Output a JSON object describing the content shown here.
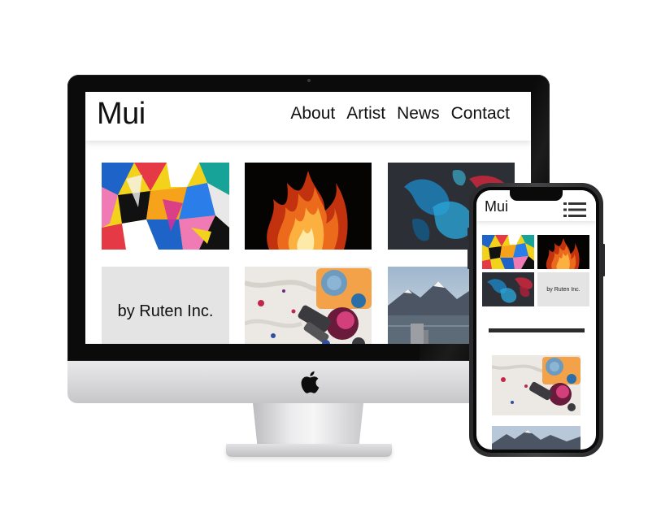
{
  "desktop_site": {
    "logo": "Mui",
    "nav": [
      "About",
      "Artist",
      "News",
      "Contact"
    ],
    "gallery_text_tile": "by Ruten Inc."
  },
  "mobile_site": {
    "logo": "Mui",
    "menu_icon": "hamburger-menu-icon",
    "gallery_text_tile": "by Ruten Inc."
  },
  "colors": {
    "bezel": "#0b0b0c",
    "chin": "#d7d7d9",
    "text_tile_bg": "#e4e4e4",
    "text": "#111111"
  }
}
